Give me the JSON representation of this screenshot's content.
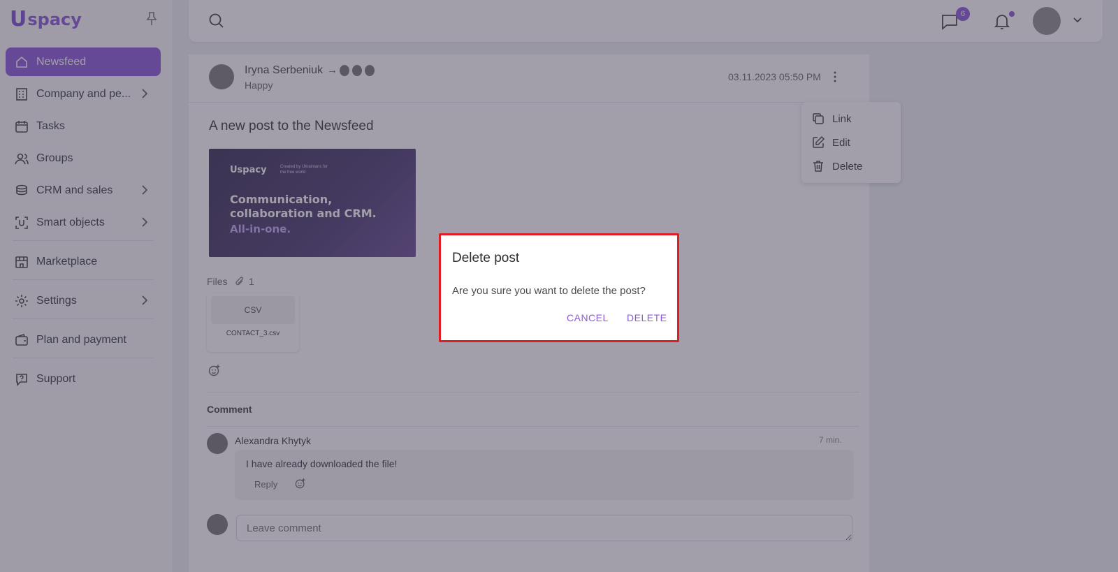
{
  "app": {
    "logo_u": "U",
    "logo_text": "spacy"
  },
  "sidebar": {
    "items": [
      {
        "label": "Newsfeed",
        "icon": "home-icon"
      },
      {
        "label": "Company and pe...",
        "icon": "building-icon"
      },
      {
        "label": "Tasks",
        "icon": "calendar-icon"
      },
      {
        "label": "Groups",
        "icon": "users-icon"
      },
      {
        "label": "CRM and sales",
        "icon": "coins-icon"
      },
      {
        "label": "Smart objects",
        "icon": "smart-object-icon"
      },
      {
        "label": "Marketplace",
        "icon": "store-icon"
      },
      {
        "label": "Settings",
        "icon": "gear-icon"
      },
      {
        "label": "Plan and payment",
        "icon": "wallet-icon"
      },
      {
        "label": "Support",
        "icon": "help-icon"
      }
    ]
  },
  "topbar": {
    "chat_badge": "6"
  },
  "post": {
    "author": "Iryna Serbeniuk",
    "arrow": "→",
    "mood": "Happy",
    "date": "03.11.2023 05:50 PM",
    "title": "A new post to the Newsfeed",
    "banner": {
      "logo": "Uspacy",
      "tagline": "Created by Ukrainians for the free world",
      "headline": "Communication, collaboration and CRM.",
      "subline": "All-in-one."
    },
    "files_label": "Files",
    "files_count": "1",
    "file": {
      "type": "CSV",
      "name": "CONTACT_3.csv"
    },
    "comment_label": "Comment",
    "comment": {
      "author": "Alexandra Khytyk",
      "time": "7 min.",
      "text": "I have already downloaded the file!",
      "reply": "Reply"
    },
    "comment_placeholder": "Leave comment"
  },
  "context_menu": {
    "link": "Link",
    "edit": "Edit",
    "delete": "Delete"
  },
  "dialog": {
    "title": "Delete post",
    "message": "Are you sure you want to delete the post?",
    "cancel": "CANCEL",
    "delete": "DELETE"
  },
  "colors": {
    "accent": "#8c5ad9",
    "highlight_border": "#e11d24"
  }
}
